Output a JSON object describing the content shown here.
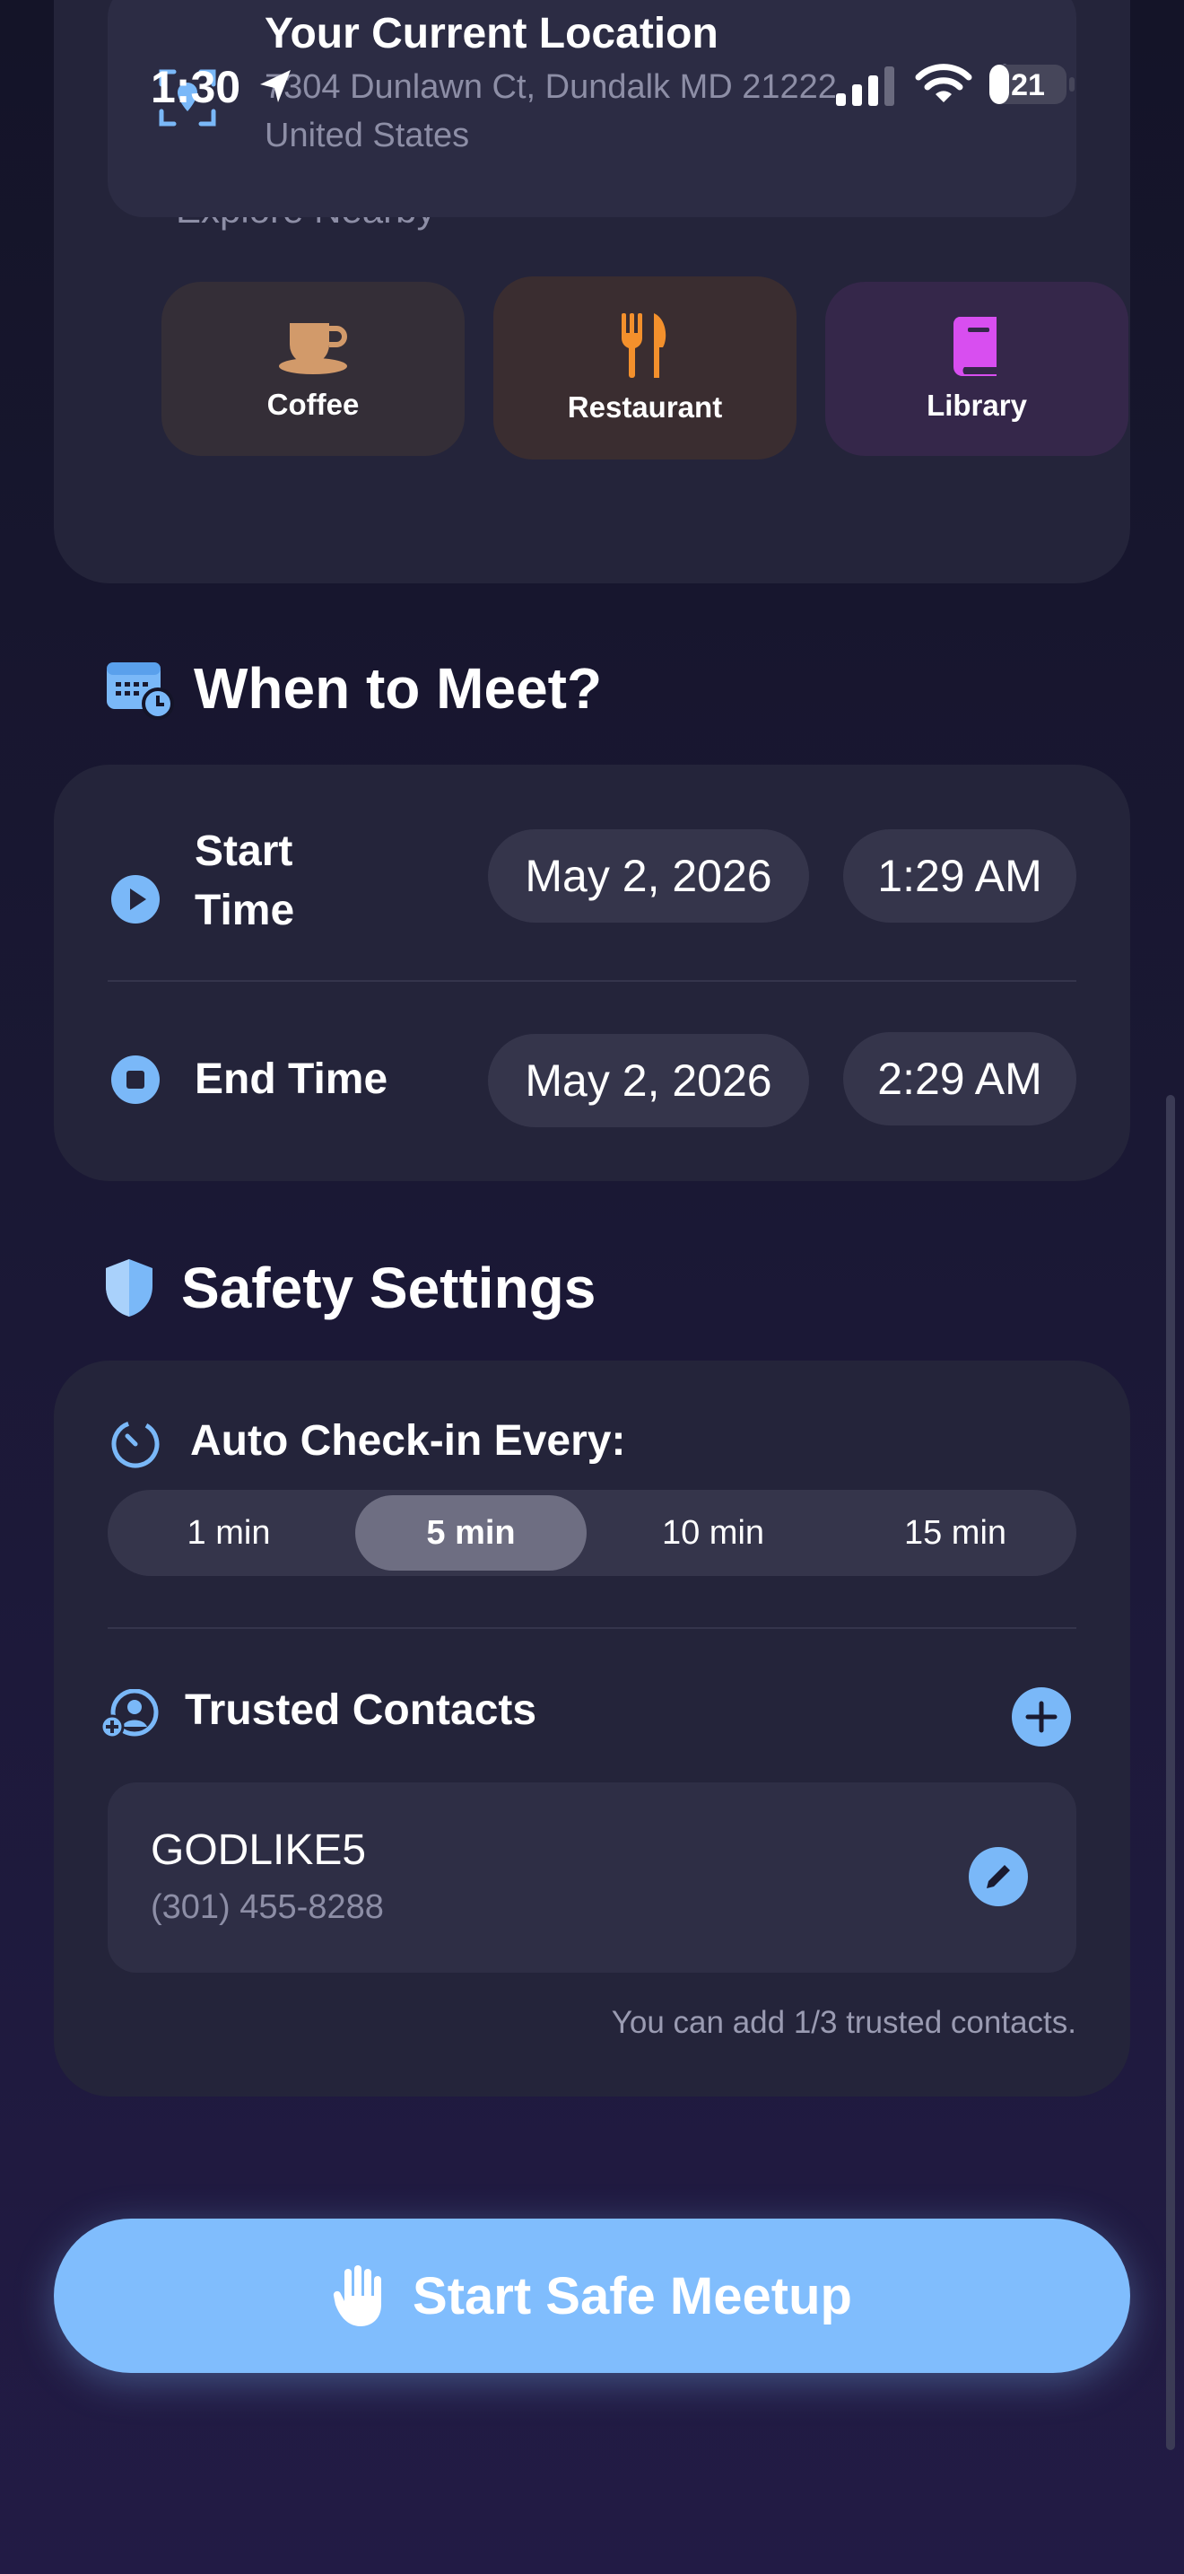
{
  "status_bar": {
    "time": "1:30",
    "battery": "21"
  },
  "location": {
    "title": "Your Current Location",
    "address": "7304 Dunlawn Ct, Dundalk MD 21222, United States"
  },
  "explore": {
    "label": "Explore Nearby",
    "items": [
      {
        "label": "Coffee",
        "icon": "coffee-icon",
        "color": "#d29a6a"
      },
      {
        "label": "Restaurant",
        "icon": "fork-knife-icon",
        "color": "#f3902c"
      },
      {
        "label": "Library",
        "icon": "book-icon",
        "color": "#d84ef0"
      }
    ]
  },
  "meet": {
    "title": "When to Meet?",
    "start": {
      "label": "Start Time",
      "date": "May 2, 2026",
      "time": "1:29 AM"
    },
    "end": {
      "label": "End Time",
      "date": "May 2, 2026",
      "time": "2:29 AM"
    }
  },
  "safety": {
    "title": "Safety Settings",
    "checkin_label": "Auto Check-in Every:",
    "intervals": [
      "1 min",
      "5 min",
      "10 min",
      "15 min"
    ],
    "selected_interval": "5 min",
    "contacts_label": "Trusted Contacts",
    "contacts": [
      {
        "name": "GODLIKE5",
        "phone": "(301) 455-8288"
      }
    ],
    "contacts_note": "You can add 1/3 trusted contacts."
  },
  "cta": {
    "label": "Start Safe Meetup"
  },
  "colors": {
    "accent": "#80bdfd",
    "card": "#24243a",
    "pill": "#35354b"
  }
}
